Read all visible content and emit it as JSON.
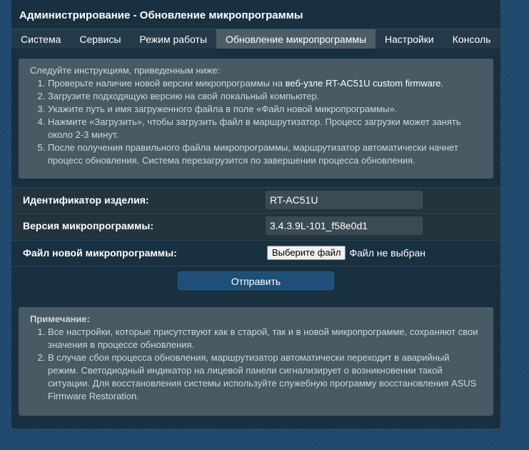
{
  "page": {
    "title": "Администрирование - Обновление микропрограммы"
  },
  "tabs": [
    {
      "label": "Система"
    },
    {
      "label": "Сервисы"
    },
    {
      "label": "Режим работы"
    },
    {
      "label": "Обновление микропрограммы",
      "active": true
    },
    {
      "label": "Настройки"
    },
    {
      "label": "Консоль"
    }
  ],
  "instructions": {
    "intro": "Следуйте инструкциям, приведенным ниже:",
    "step1_pre": "Проверьте наличие новой версии микропрограммы на ",
    "step1_link": "веб-узле RT-AC51U custom firmware",
    "step1_post": ".",
    "step2": "Загрузите подходящую версию на свой локальный компьютер.",
    "step3": "Укажите путь и имя загруженного файла в поле «Файл новой микропрограммы».",
    "step4": "Нажмите «Загрузить», чтобы загрузить файл в маршрутизатор. Процесс загрузки может занять около 2-3 минут.",
    "step5": "После получения правильного файла микропрограммы, маршрутизатор автоматически начнет процесс обновления. Система перезагрузится по завершении процесса обновления."
  },
  "form": {
    "product_id_label": "Идентификатор изделия:",
    "product_id_value": "RT-AC51U",
    "fw_version_label": "Версия микропрограммы:",
    "fw_version_value": "3.4.3.9L-101_f58e0d1",
    "new_fw_label": "Файл новой микропрограммы:",
    "choose_file_button": "Выберите файл",
    "file_status": "Файл не выбран",
    "submit_label": "Отправить"
  },
  "note": {
    "title": "Примечание:",
    "item1": "Все настройки, которые присутствуют как в старой, так и в новой микропрограмме, сохраняют свои значения в процессе обновления.",
    "item2": "В случае сбоя процесса обновления, маршрутизатор автоматически переходит в аварийный режим. Светодиодный индикатор на лицевой панели сигнализирует о возникновении такой ситуации. Для восстановления системы используйте служебную программу восстановления ASUS Firmware Restoration."
  }
}
